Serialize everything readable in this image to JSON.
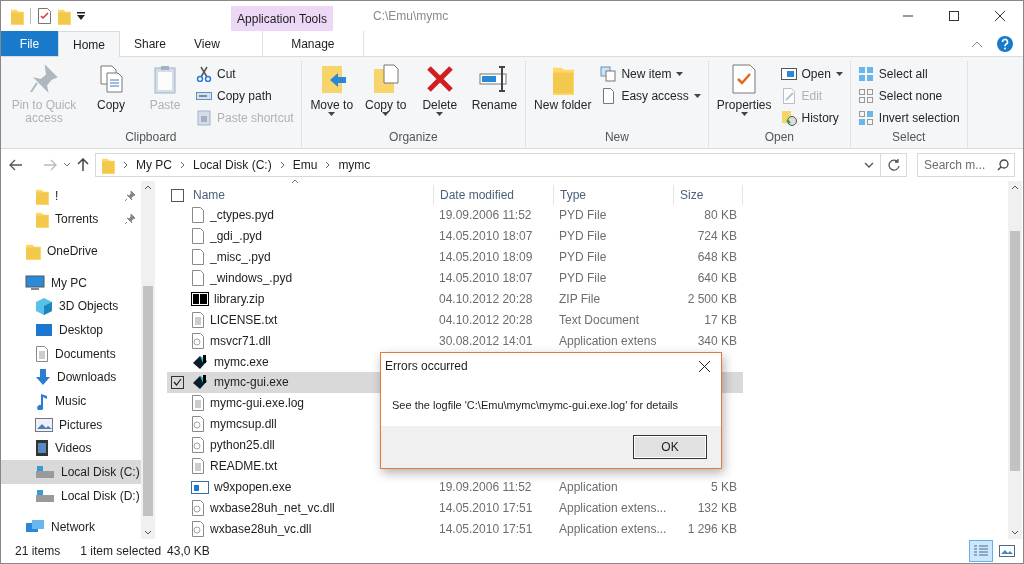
{
  "title_bar": {
    "context_tab": "Application Tools",
    "path": "C:\\Emu\\mymc"
  },
  "ribbon_tabs": [
    {
      "label": "File",
      "kind": "file",
      "selected": false
    },
    {
      "label": "Home",
      "kind": "tab",
      "selected": true
    },
    {
      "label": "Share",
      "kind": "tab",
      "selected": false
    },
    {
      "label": "View",
      "kind": "tab",
      "selected": false
    },
    {
      "label": "Manage",
      "kind": "context",
      "selected": false
    }
  ],
  "ribbon_groups": [
    {
      "label": "Clipboard",
      "items": [
        {
          "label": "Pin to Quick access",
          "kind": "large",
          "disabled": true,
          "dropdown": false
        },
        {
          "label": "Copy",
          "kind": "large",
          "disabled": false,
          "dropdown": false
        },
        {
          "label": "Paste",
          "kind": "large",
          "disabled": true,
          "dropdown": false
        },
        {
          "label": "Cut",
          "kind": "small",
          "disabled": false,
          "dropdown": false
        },
        {
          "label": "Copy path",
          "kind": "small",
          "disabled": false,
          "dropdown": false
        },
        {
          "label": "Paste shortcut",
          "kind": "small",
          "disabled": true,
          "dropdown": false
        }
      ]
    },
    {
      "label": "Organize",
      "items": [
        {
          "label": "Move to",
          "kind": "large",
          "disabled": false,
          "dropdown": true
        },
        {
          "label": "Copy to",
          "kind": "large",
          "disabled": false,
          "dropdown": true
        },
        {
          "label": "Delete",
          "kind": "large",
          "disabled": false,
          "dropdown": true
        },
        {
          "label": "Rename",
          "kind": "large",
          "disabled": false,
          "dropdown": false
        }
      ]
    },
    {
      "label": "New",
      "items": [
        {
          "label": "New folder",
          "kind": "large",
          "disabled": false,
          "dropdown": false
        },
        {
          "label": "New item",
          "kind": "small",
          "disabled": false,
          "dropdown": true
        },
        {
          "label": "Easy access",
          "kind": "small",
          "disabled": false,
          "dropdown": true
        }
      ]
    },
    {
      "label": "Open",
      "items": [
        {
          "label": "Properties",
          "kind": "large",
          "disabled": false,
          "dropdown": true
        },
        {
          "label": "Open",
          "kind": "small",
          "disabled": false,
          "dropdown": true
        },
        {
          "label": "Edit",
          "kind": "small",
          "disabled": true,
          "dropdown": false
        },
        {
          "label": "History",
          "kind": "small",
          "disabled": false,
          "dropdown": false
        }
      ]
    },
    {
      "label": "Select",
      "items": [
        {
          "label": "Select all",
          "kind": "small",
          "disabled": false,
          "dropdown": false
        },
        {
          "label": "Select none",
          "kind": "small",
          "disabled": false,
          "dropdown": false
        },
        {
          "label": "Invert selection",
          "kind": "small",
          "disabled": false,
          "dropdown": false
        }
      ]
    }
  ],
  "address_bar": {
    "crumbs": [
      "My PC",
      "Local Disk (C:)",
      "Emu",
      "mymc"
    ],
    "search_placeholder": "Search m..."
  },
  "navigation": {
    "pinned": [
      {
        "label": "!",
        "selected": false
      },
      {
        "label": "Torrents",
        "selected": false
      }
    ],
    "items": [
      {
        "label": "OneDrive",
        "kind": "cloud",
        "selected": false
      },
      {
        "label": "My PC",
        "kind": "pc",
        "selected": false,
        "children": [
          {
            "label": "3D Objects",
            "kind": "cube",
            "selected": false
          },
          {
            "label": "Desktop",
            "kind": "desktop",
            "selected": false
          },
          {
            "label": "Documents",
            "kind": "docs",
            "selected": false
          },
          {
            "label": "Downloads",
            "kind": "down",
            "selected": false
          },
          {
            "label": "Music",
            "kind": "music",
            "selected": false
          },
          {
            "label": "Pictures",
            "kind": "pictures",
            "selected": false
          },
          {
            "label": "Videos",
            "kind": "videos",
            "selected": false
          },
          {
            "label": "Local Disk (C:)",
            "kind": "disk",
            "selected": true
          },
          {
            "label": "Local Disk (D:)",
            "kind": "disk",
            "selected": false
          }
        ]
      },
      {
        "label": "Network",
        "kind": "network",
        "selected": false
      }
    ]
  },
  "file_list": {
    "columns": [
      "Name",
      "Date modified",
      "Type",
      "Size"
    ],
    "select_all_checked": false,
    "rows": [
      {
        "kind": "file",
        "name": "_ctypes.pyd",
        "date": "19.09.2006 11:52",
        "type": "PYD File",
        "size": "80 KB",
        "selected": false
      },
      {
        "kind": "file",
        "name": "_gdi_.pyd",
        "date": "14.05.2010 18:07",
        "type": "PYD File",
        "size": "724 KB",
        "selected": false
      },
      {
        "kind": "file",
        "name": "_misc_.pyd",
        "date": "14.05.2010 18:09",
        "type": "PYD File",
        "size": "648 KB",
        "selected": false
      },
      {
        "kind": "file",
        "name": "_windows_.pyd",
        "date": "14.05.2010 18:07",
        "type": "PYD File",
        "size": "640 KB",
        "selected": false
      },
      {
        "kind": "zip",
        "name": "library.zip",
        "date": "04.10.2012 20:28",
        "type": "ZIP File",
        "size": "2 500 KB",
        "selected": false
      },
      {
        "kind": "text",
        "name": "LICENSE.txt",
        "date": "04.10.2012 20:28",
        "type": "Text Document",
        "size": "17 KB",
        "selected": false
      },
      {
        "kind": "dll",
        "name": "msvcr71.dll",
        "date": "30.08.2012 14:01",
        "type": "Application extens",
        "size": "340 KB",
        "selected": false
      },
      {
        "kind": "exe",
        "name": "mymc.exe",
        "selected": false
      },
      {
        "kind": "exe",
        "name": "mymc-gui.exe",
        "selected": true
      },
      {
        "kind": "text",
        "name": "mymc-gui.exe.log",
        "selected": false
      },
      {
        "kind": "dll",
        "name": "mymcsup.dll",
        "selected": false
      },
      {
        "kind": "dll",
        "name": "python25.dll",
        "selected": false
      },
      {
        "kind": "text",
        "name": "README.txt",
        "selected": false
      },
      {
        "kind": "app",
        "name": "w9xpopen.exe",
        "date": "19.09.2006 11:52",
        "type": "Application",
        "size": "5 KB",
        "selected": false
      },
      {
        "kind": "dll",
        "name": "wxbase28uh_net_vc.dll",
        "date": "14.05.2010 17:51",
        "type": "Application extens...",
        "size": "132 KB",
        "selected": false
      },
      {
        "kind": "dll",
        "name": "wxbase28uh_vc.dll",
        "date": "14.05.2010 17:51",
        "type": "Application extens...",
        "size": "1 296 KB",
        "selected": false
      }
    ]
  },
  "status_bar": {
    "count": "21 items",
    "selection": "1 item selected",
    "selection_size": "43,0 KB",
    "views": [
      {
        "kind": "details",
        "selected": true
      },
      {
        "kind": "large",
        "selected": false
      }
    ]
  },
  "dialog": {
    "title": "Errors occurred",
    "message": "See the logfile 'C:\\Emu\\mymc\\mymc-gui.exe.log' for details",
    "button": "OK"
  }
}
